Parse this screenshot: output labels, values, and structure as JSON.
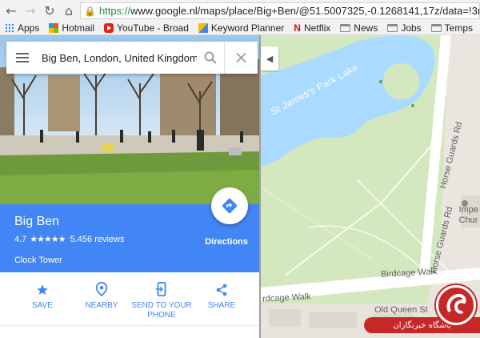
{
  "browser": {
    "url_scheme": "https://",
    "url_rest": "www.google.nl/maps/place/Big+Ben/@51.5007325,-0.1268141,17z/data=!3m",
    "bookmarks": [
      {
        "label": "Apps",
        "icon": "apps-icon"
      },
      {
        "label": "Hotmail",
        "icon": "hotmail-icon"
      },
      {
        "label": "YouTube - Broad",
        "icon": "youtube-icon"
      },
      {
        "label": "Keyword Planner",
        "icon": "keyword-planner-icon"
      },
      {
        "label": "Netflix",
        "icon": "netflix-icon"
      },
      {
        "label": "News",
        "icon": "folder-icon"
      },
      {
        "label": "Jobs",
        "icon": "folder-icon"
      },
      {
        "label": "Temps",
        "icon": "folder-icon"
      }
    ]
  },
  "search": {
    "value": "Big Ben, London, United Kingdom"
  },
  "place": {
    "title": "Big Ben",
    "rating": "4.7",
    "stars": "★★★★★",
    "reviews": "5.456 reviews",
    "category": "Clock Tower",
    "directions_label": "Directions"
  },
  "actions": {
    "save": "SAVE",
    "nearby": "NEARBY",
    "send_line1": "SEND TO YOUR",
    "send_line2": "PHONE",
    "share": "SHARE"
  },
  "map": {
    "lake_label": "St James's Park Lake",
    "horse_guards_1": "Horse Guards Rd",
    "horse_guards_2": "Horse Guards Rd",
    "birdcage_1": "rdcage Walk",
    "birdcage_2": "Birdcage Walk",
    "impe_1": "Impe",
    "impe_2": "Chur",
    "old_queen_st": "Old Queen St"
  },
  "watermark": {
    "text": "باشگاه خبرنگاران"
  },
  "colors": {
    "accent": "#4285f4",
    "water": "#aadaff",
    "park": "#d4e8bf"
  }
}
